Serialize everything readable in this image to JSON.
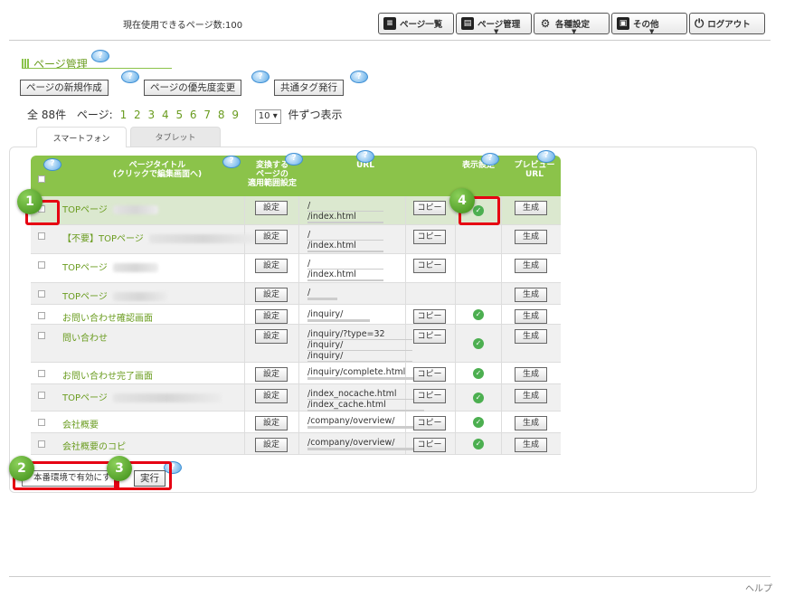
{
  "header": {
    "usage_text": "現在使用できるページ数:100",
    "buttons": [
      {
        "label": "ページ一覧",
        "icon": "page-list-icon"
      },
      {
        "label": "ページ管理",
        "icon": "page-manage-icon"
      },
      {
        "label": "各種設定",
        "icon": "gears-icon"
      },
      {
        "label": "その他",
        "icon": "other-icon"
      },
      {
        "label": "ログアウト",
        "icon": "power-icon"
      }
    ]
  },
  "section": {
    "title": "ページ管理",
    "actions": [
      "ページの新規作成",
      "ページの優先度変更",
      "共通タグ発行"
    ]
  },
  "pager": {
    "total": "全 88件",
    "page_label": "ページ:",
    "pages": [
      "1",
      "2",
      "3",
      "4",
      "5",
      "6",
      "7",
      "8",
      "9"
    ],
    "per_page_value": "10",
    "per_page_suffix": "件ずつ表示"
  },
  "tabs": [
    "スマートフォン",
    "タブレット"
  ],
  "table": {
    "headers": {
      "title_line1": "ページタイトル",
      "title_line2": "(クリックで編集画面へ)",
      "setting_line1": "変換する",
      "setting_line2": "ページの",
      "setting_line3": "適用範囲設定",
      "url": "URL",
      "display": "表示設定",
      "preview_line1": "プレビュー",
      "preview_line2": "URL"
    },
    "setting_label": "設定",
    "copy_label": "コピー",
    "generate_label": "生成",
    "rows": [
      {
        "title": "TOPページ",
        "url1": "/",
        "url2": "/index.html",
        "url3": "",
        "shown": true
      },
      {
        "title": "【不要】TOPページ",
        "url1": "/",
        "url2": "/index.html",
        "url3": "",
        "shown": false
      },
      {
        "title": "TOPページ",
        "url1": "/",
        "url2": "/index.html",
        "url3": "",
        "shown": false
      },
      {
        "title": "TOPページ",
        "url1": "/",
        "url2": "",
        "url3": "",
        "shown": false
      },
      {
        "title": "お問い合わせ確認画面",
        "url1": "/inquiry/",
        "url2": "",
        "url3": "",
        "shown": true
      },
      {
        "title": "問い合わせ",
        "url1": "/inquiry/?type=32",
        "url2": "/inquiry/",
        "url3": "/inquiry/",
        "shown": true
      },
      {
        "title": "お問い合わせ完了画面",
        "url1": "/inquiry/complete.html",
        "url2": "",
        "url3": "",
        "shown": true
      },
      {
        "title": "TOPページ",
        "url1": "/index_nocache.html",
        "url2": "/index_cache.html",
        "url3": "",
        "shown": true
      },
      {
        "title": "会社概要",
        "url1": "/company/overview/",
        "url2": "",
        "url3": "",
        "shown": true
      },
      {
        "title": "会社概要のコピ",
        "url1": "/company/overview/",
        "url2": "",
        "url3": "",
        "shown": true
      }
    ]
  },
  "footer": {
    "bulk_select": "本番環境で有効にす",
    "execute": "実行",
    "help": "ヘルプ"
  },
  "callouts": [
    "1",
    "2",
    "3",
    "4"
  ],
  "colors": {
    "accent": "#8bc34a",
    "link": "#6a9c1f",
    "callout": "#e60012"
  }
}
